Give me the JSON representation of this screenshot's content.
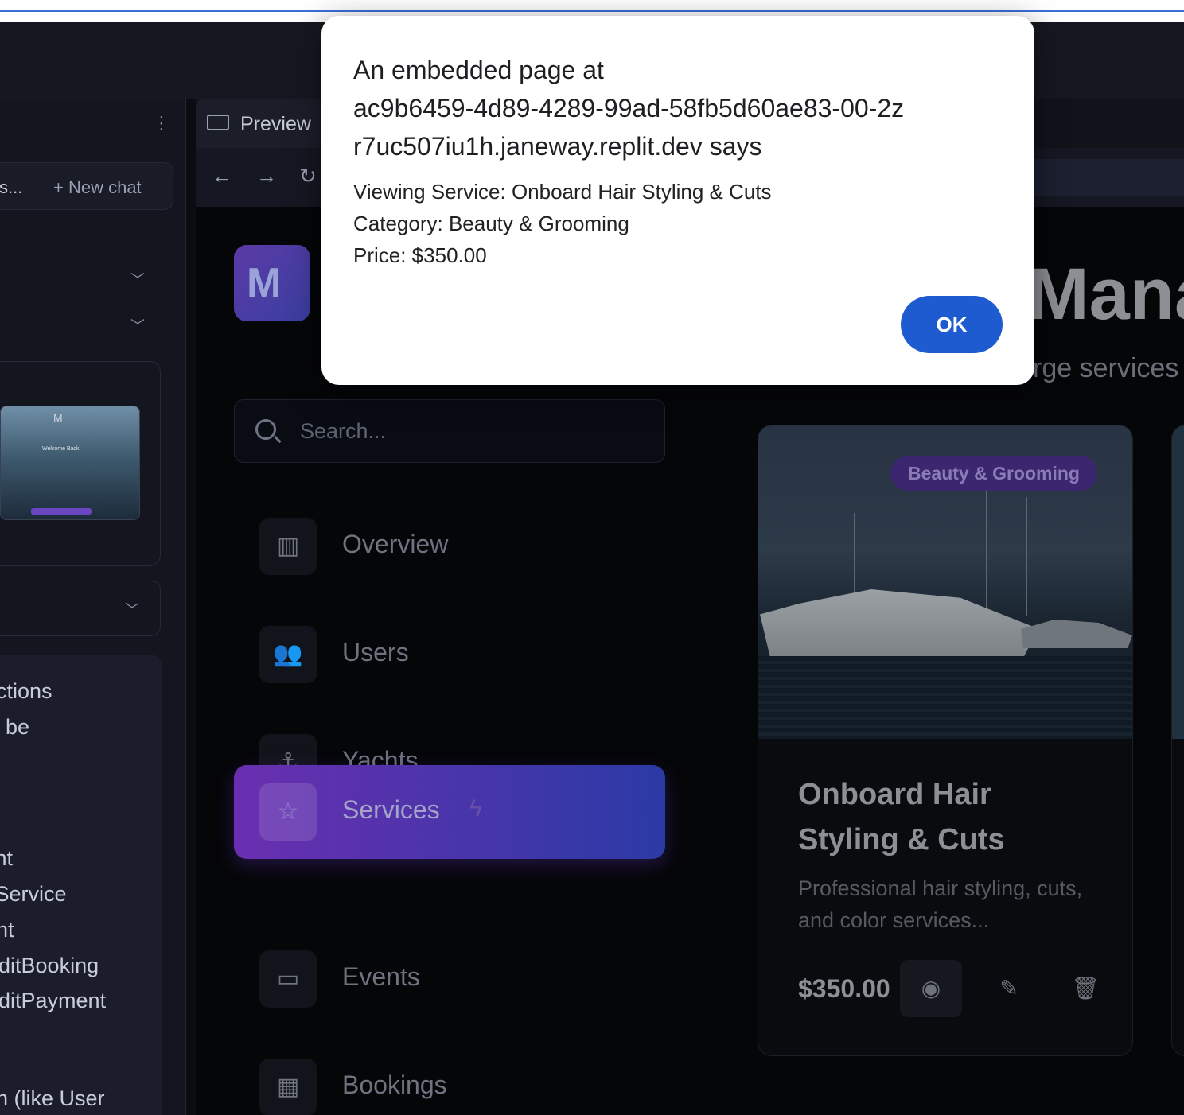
{
  "dialog": {
    "title_line1": "An embedded page at",
    "title_line2": "ac9b6459-4d89-4289-99ad-58fb5d60ae83-00-2z",
    "title_line3": "r7uc507iu1h.janeway.replit.dev says",
    "line1": "Viewing Service: Onboard Hair Styling & Cuts",
    "line2": "Category: Beauty & Grooming",
    "line3": "Price: $350.00",
    "ok_label": "OK"
  },
  "left_pane": {
    "truncated_label": "s...",
    "new_chat_label": "+ New chat",
    "thumbnail_text": "Welcome Back",
    "message_lines": [
      "nctions",
      "w be",
      ".",
      "cht",
      "itService",
      "ent",
      "EditBooking",
      "EditPayment",
      "on (like User"
    ]
  },
  "preview": {
    "tab_label": "Preview"
  },
  "app": {
    "title_partial": "Mana",
    "subtitle_partial": "rge services",
    "search_placeholder": "Search...",
    "nav": [
      {
        "label": "Overview",
        "icon": "bar-chart-icon"
      },
      {
        "label": "Users",
        "icon": "users-icon"
      },
      {
        "label": "Yachts",
        "icon": "anchor-icon"
      },
      {
        "label": "Services",
        "icon": "star-icon",
        "active": true
      },
      {
        "label": "Events",
        "icon": "calendar-icon"
      },
      {
        "label": "Bookings",
        "icon": "calendar-grid-icon"
      }
    ],
    "card": {
      "category": "Beauty & Grooming",
      "title": "Onboard Hair Styling & Cuts",
      "description": "Professional hair styling, cuts, and color services...",
      "price": "$350.00"
    }
  }
}
